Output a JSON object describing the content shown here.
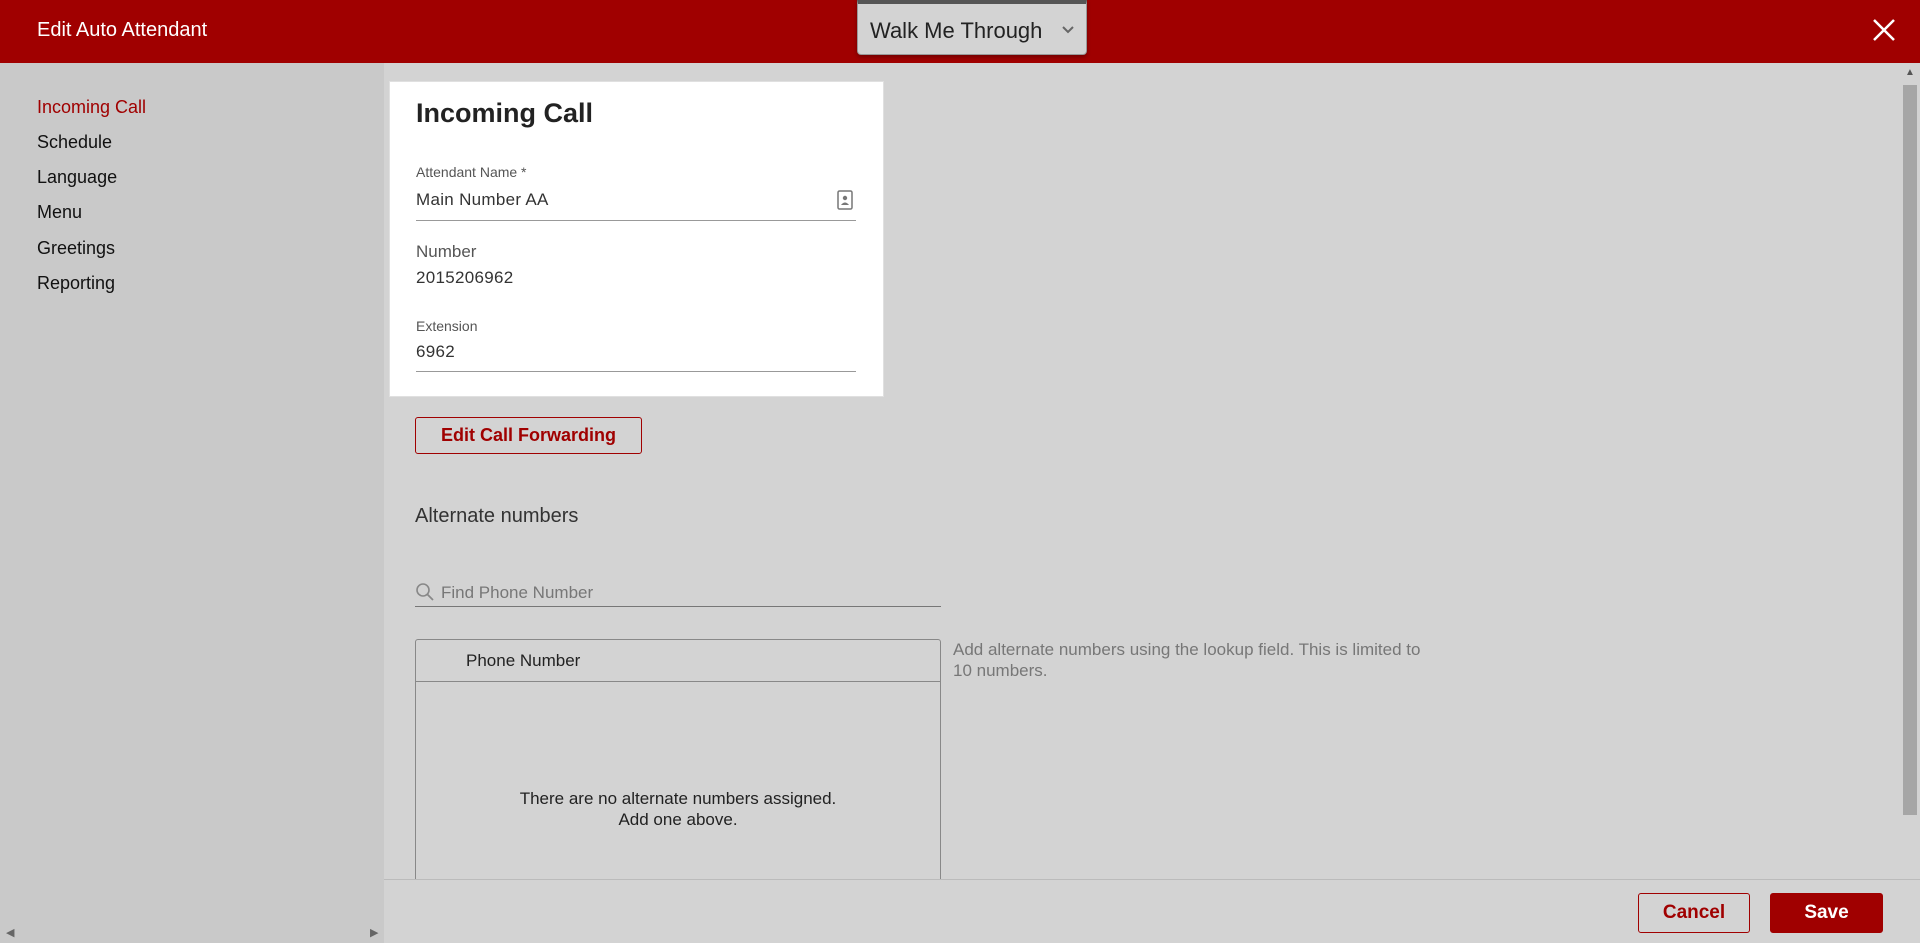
{
  "header": {
    "title": "Edit Auto Attendant",
    "walk_me_through": "Walk Me Through",
    "accent": "#a00000"
  },
  "sidebar": {
    "items": [
      {
        "label": "Incoming Call",
        "active": true
      },
      {
        "label": "Schedule",
        "active": false
      },
      {
        "label": "Language",
        "active": false
      },
      {
        "label": "Menu",
        "active": false
      },
      {
        "label": "Greetings",
        "active": false
      },
      {
        "label": "Reporting",
        "active": false
      }
    ]
  },
  "card": {
    "title": "Incoming Call",
    "attendant_name_label": "Attendant Name *",
    "attendant_name_value": "Main Number AA",
    "number_label": "Number",
    "number_value": "2015206962",
    "extension_label": "Extension",
    "extension_value": "6962"
  },
  "edit_call_forwarding": "Edit Call Forwarding",
  "alternate": {
    "heading": "Alternate numbers",
    "search_placeholder": "Find Phone Number",
    "table_header": "Phone Number",
    "empty_line1": "There are no alternate numbers assigned.",
    "empty_line2": "Add one above.",
    "hint": "Add alternate numbers using the lookup field. This is limited to 10 numbers."
  },
  "footer": {
    "cancel": "Cancel",
    "save": "Save"
  }
}
